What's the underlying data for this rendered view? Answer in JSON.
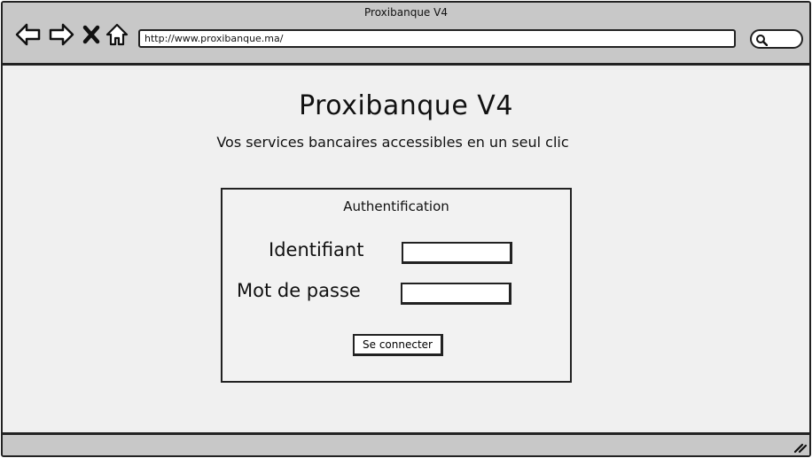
{
  "window": {
    "title": "Proxibanque V4"
  },
  "toolbar": {
    "back_icon": "back-arrow-icon",
    "forward_icon": "forward-arrow-icon",
    "close_icon": "close-icon",
    "home_icon": "home-icon",
    "address": "http://www.proxibanque.ma/",
    "search_icon": "search-icon"
  },
  "page": {
    "title": "Proxibanque V4",
    "tagline": "Vos services bancaires accessibles en un seul clic"
  },
  "auth": {
    "title": "Authentification",
    "identifier_label": "Identifiant",
    "identifier_value": "",
    "password_label": "Mot de passe",
    "password_value": "",
    "submit_label": "Se connecter"
  },
  "colors": {
    "chrome": "#c8c8c8",
    "background": "#f0f0f0",
    "border": "#222222"
  }
}
